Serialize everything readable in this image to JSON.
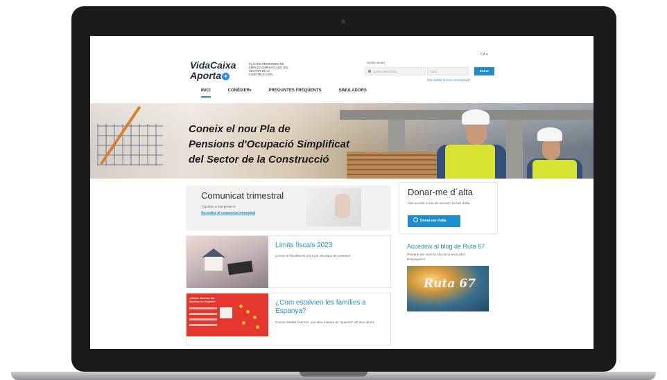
{
  "header": {
    "logo_line1": "VidaCaixa",
    "logo_line2": "Aporta",
    "logo_description": "PLAN DE PENSIONES DE EMPLEO SIMPLIFICADO DEL SECTOR DE LA CONSTRUCCIÓN",
    "language": "CA ▾",
    "login_label": "Accés usuari",
    "user_placeholder": "Correu electrònic",
    "password_placeholder": "Clau",
    "enter_label": "Entrar",
    "forgot_link": "Has oblidat la teva contrasenya?"
  },
  "nav": {
    "items": [
      {
        "label": "INICI"
      },
      {
        "label": "CONÈIXER"
      },
      {
        "label": "PREGUNTES FREQÜENTS"
      },
      {
        "label": "SIMULADORS"
      }
    ],
    "caret": "▾"
  },
  "banner": {
    "line1": "Coneix el nou Pla de",
    "line2": "Pensions d'Ocupació Simplificat",
    "line3": "del Sector de la Construcció"
  },
  "cards": {
    "comunicat": {
      "title": "Comunicat trimestral",
      "subtitle": "T'ajudem a interpretar-lo",
      "link": "Accedeix al comunicat trimestral"
    },
    "donar": {
      "title": "Donar-me d´alta",
      "text": "Vols accedir a tots els serveis? Dona't d'alta",
      "button": "Donar-me d'alta"
    },
    "limits": {
      "title": "Límits fiscals 2023",
      "text": "Coneix la fiscalitat de 2023 per als plans de pensions"
    },
    "blog": {
      "title": "Accedeix al blog de Ruta 67",
      "text": "Preparat per viure la ruta de la teva vida? Despeguem!",
      "logo": "Ruta 67"
    },
    "familia": {
      "title": "¿Com estalvien les famílies a Espanya?",
      "text": "Coneix l'estalvi financer: una altra manera de \"guardar\" els teus diners",
      "infographic_title": "¿Cómo ahorran las familias en España?"
    }
  },
  "colors": {
    "accent": "#1f8ccc",
    "frame": "#1b1b1d",
    "infographic": "#e4362c"
  }
}
